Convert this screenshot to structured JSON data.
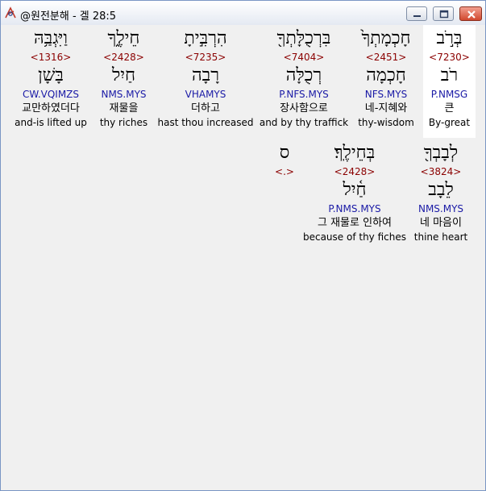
{
  "window": {
    "title": "@원전분해 - 겔 28:5",
    "accent": "#d0482e"
  },
  "words": [
    {
      "hebrew": "בְּרֹ֣ב",
      "strong": "<7230>",
      "root": "רֹב",
      "parse": "P.NMSG",
      "korean": "큰",
      "english": "By-great"
    },
    {
      "hebrew": "חָכְמָתְךָ֙",
      "strong": "<2451>",
      "root": "חָכְמָה",
      "parse": "NFS.MYS",
      "korean": "네-지혜와",
      "english": "thy-wisdom"
    },
    {
      "hebrew": "בִּרְכֻלָּתְךָ֖",
      "strong": "<7404>",
      "root": "רְכֻלָּה",
      "parse": "P.NFS.MYS",
      "korean": "장사함으로",
      "english": "and by thy traffick"
    },
    {
      "hebrew": "הִרְבִּ֣יתָ",
      "strong": "<7235>",
      "root": "רָבָה",
      "parse": "VHAMYS",
      "korean": "더하고",
      "english": "hast thou increased"
    },
    {
      "hebrew": "חֵילֶ֑ךָ",
      "strong": "<2428>",
      "root": "חַיִל",
      "parse": "NMS.MYS",
      "korean": "재물을",
      "english": "thy riches"
    },
    {
      "hebrew": "וַיִּגְבַּ֥הּ",
      "strong": "<1316>",
      "root": "בָּשָׁן",
      "parse": "CW.VQIMZS",
      "korean": "교만하였더다",
      "english": "and-is lifted up"
    },
    {
      "hebrew": "לְבָבְךָ֖",
      "strong": "<3824>",
      "root": "לֵבָב",
      "parse": "NMS.MYS",
      "korean": "네 마음이",
      "english": "thine heart"
    },
    {
      "hebrew": "בְּחֵילֶֽךָ׃",
      "strong": "<2428>",
      "root": "חַ֫יִל",
      "parse": "P.NMS.MYS",
      "korean": "그 재물로 인하여",
      "english": "because of thy fiches"
    },
    {
      "hebrew": "ס",
      "strong": "<.>",
      "root": "",
      "parse": "",
      "korean": "",
      "english": ""
    }
  ]
}
